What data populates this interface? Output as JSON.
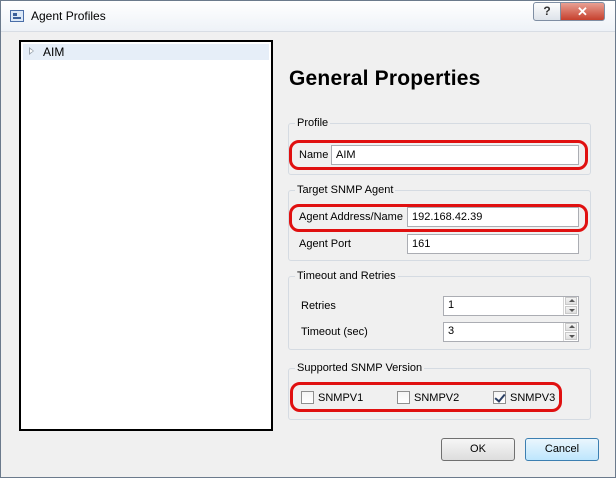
{
  "window": {
    "title": "Agent Profiles",
    "help_label": "?",
    "close_label": "✕",
    "icon": "app-icon"
  },
  "tree": {
    "items": [
      {
        "label": "AIM",
        "expander": "collapsed-arrow-icon"
      }
    ]
  },
  "page": {
    "heading": "General Properties"
  },
  "profile": {
    "group_label": "Profile",
    "name_label": "Name",
    "name_value": "AIM"
  },
  "target": {
    "group_label": "Target SNMP Agent",
    "address_label": "Agent Address/Name",
    "address_value": "192.168.42.39",
    "port_label": "Agent Port",
    "port_value": "161"
  },
  "timeout": {
    "group_label": "Timeout and Retries",
    "retries_label": "Retries",
    "retries_value": "1",
    "timeout_label": "Timeout (sec)",
    "timeout_value": "3"
  },
  "snmp": {
    "group_label": "Supported SNMP Version",
    "options": [
      {
        "label": "SNMPV1",
        "checked": false
      },
      {
        "label": "SNMPV2",
        "checked": false
      },
      {
        "label": "SNMPV3",
        "checked": true
      }
    ]
  },
  "buttons": {
    "ok": "OK",
    "cancel": "Cancel"
  },
  "colors": {
    "highlight": "#e01010",
    "selection": "#e6eef8"
  }
}
